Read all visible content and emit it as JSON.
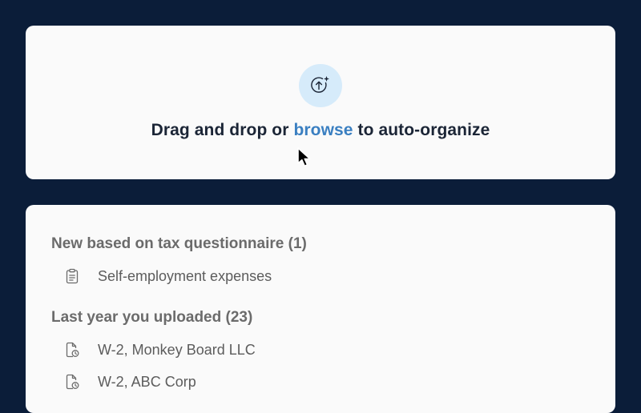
{
  "upload": {
    "icon": "upload-sparkle-icon",
    "text_before": "Drag and drop or ",
    "link": "browse",
    "text_after": " to auto-organize"
  },
  "sections": [
    {
      "title": "New based on tax questionnaire (1)",
      "items": [
        {
          "label": "Self-employment expenses",
          "icon": "clipboard-icon"
        }
      ]
    },
    {
      "title": "Last year you uploaded (23)",
      "items": [
        {
          "label": "W-2, Monkey Board LLC",
          "icon": "document-clock-icon"
        },
        {
          "label": "W-2, ABC Corp",
          "icon": "document-clock-icon"
        }
      ]
    }
  ],
  "colors": {
    "background": "#0b1d39",
    "card": "#fafafa",
    "link": "#3a7fc1",
    "icon_circle": "#d6ebfa"
  }
}
